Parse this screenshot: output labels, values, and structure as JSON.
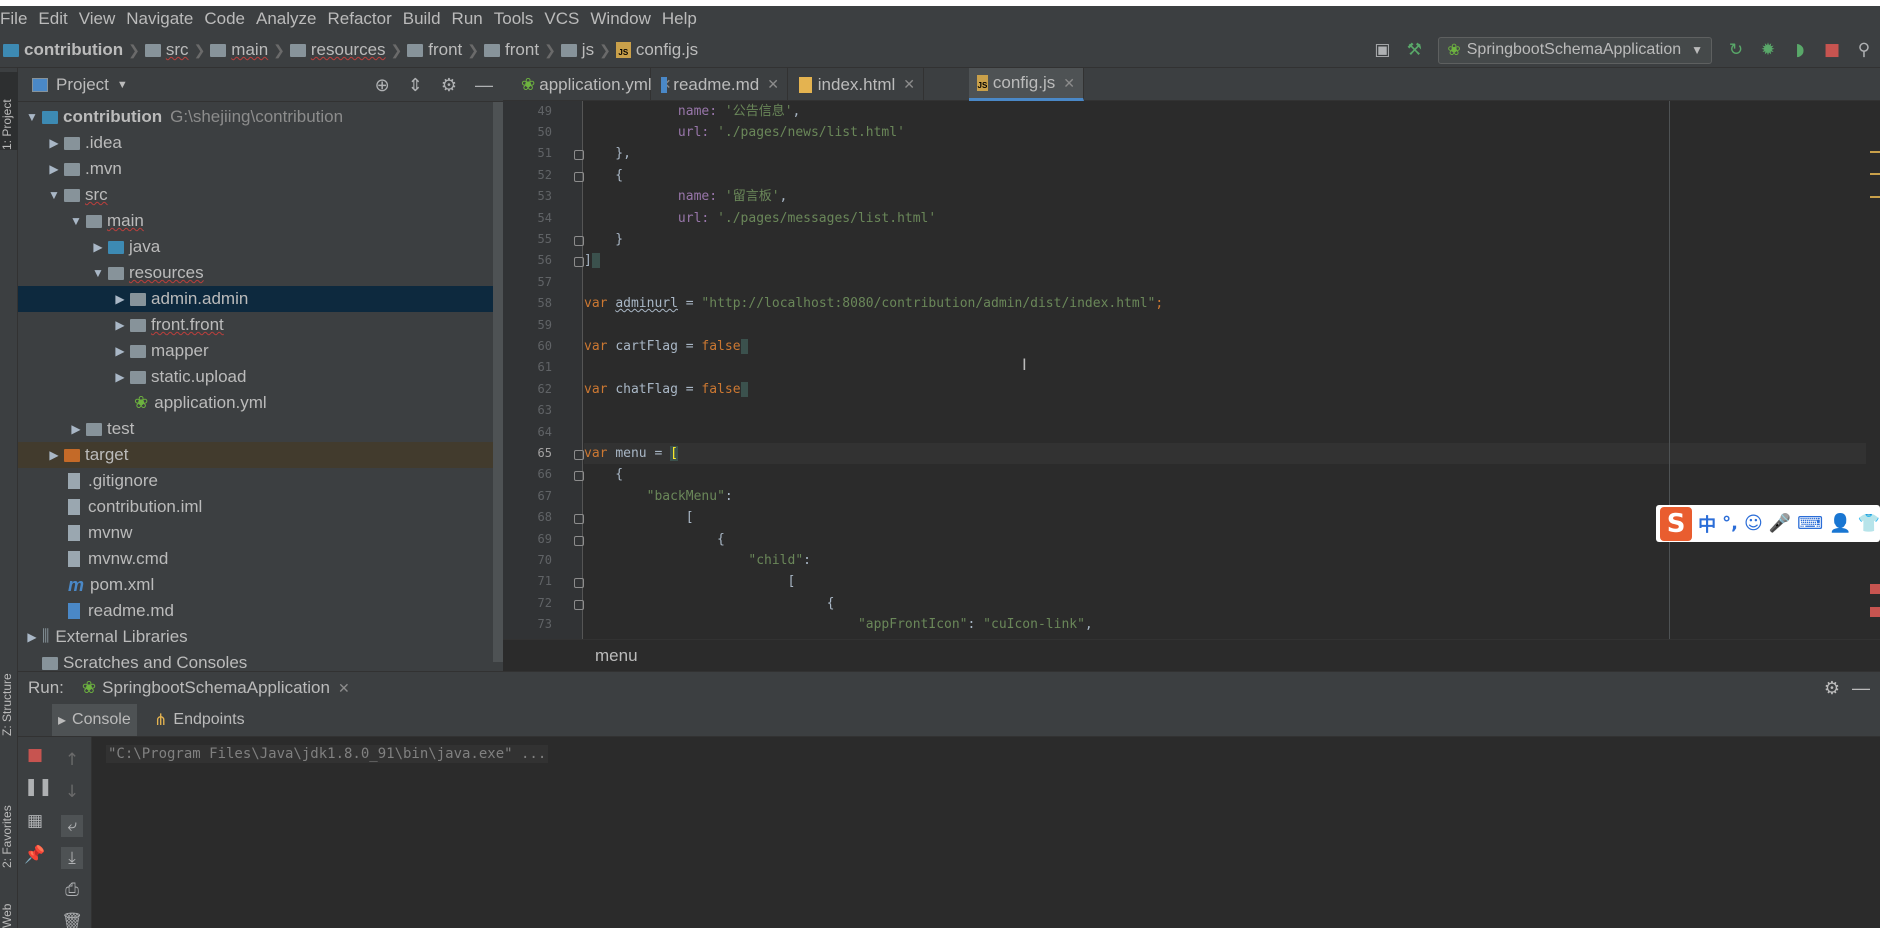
{
  "menu": [
    "File",
    "Edit",
    "View",
    "Navigate",
    "Code",
    "Analyze",
    "Refactor",
    "Build",
    "Run",
    "Tools",
    "VCS",
    "Window",
    "Help"
  ],
  "breadcrumbs": [
    "contribution",
    "src",
    "main",
    "resources",
    "front",
    "front",
    "js",
    "config.js"
  ],
  "run_config": "SpringbootSchemaApplication",
  "left_tabs": {
    "project": "1: Project",
    "structure": "Z: Structure",
    "favorites": "2: Favorites",
    "web": "Web"
  },
  "project": {
    "title": "Project",
    "tree": [
      {
        "label": "contribution",
        "hint": "G:\\shejiing\\contribution"
      },
      {
        "label": ".idea"
      },
      {
        "label": ".mvn"
      },
      {
        "label": "src"
      },
      {
        "label": "main"
      },
      {
        "label": "java"
      },
      {
        "label": "resources"
      },
      {
        "label": "admin.admin"
      },
      {
        "label": "front.front"
      },
      {
        "label": "mapper"
      },
      {
        "label": "static.upload"
      },
      {
        "label": "application.yml"
      },
      {
        "label": "test"
      },
      {
        "label": "target"
      },
      {
        "label": ".gitignore"
      },
      {
        "label": "contribution.iml"
      },
      {
        "label": "mvnw"
      },
      {
        "label": "mvnw.cmd"
      },
      {
        "label": "pom.xml"
      },
      {
        "label": "readme.md"
      },
      {
        "label": "External Libraries"
      },
      {
        "label": "Scratches and Consoles"
      }
    ]
  },
  "tabs": [
    {
      "label": "application.yml",
      "icon": "yml"
    },
    {
      "label": "readme.md",
      "icon": "MD"
    },
    {
      "label": "index.html",
      "icon": "H"
    },
    {
      "label": "config.js",
      "icon": "JS"
    }
  ],
  "editor": {
    "line_numbers": [
      "49",
      "50",
      "51",
      "52",
      "53",
      "54",
      "55",
      "56",
      "57",
      "58",
      "59",
      "60",
      "61",
      "62",
      "63",
      "64",
      "65",
      "66",
      "67",
      "68",
      "69",
      "70",
      "71",
      "72",
      "73"
    ],
    "lines": {
      "l49a": "            name: ",
      "l49b": "'公告信息'",
      "l49c": ",",
      "l50a": "            url: ",
      "l50b": "'./pages/news/list.html'",
      "l51": "    },",
      "l52": "    {",
      "l53a": "            name: ",
      "l53b": "'留言板'",
      "l53c": ",",
      "l54a": "            url: ",
      "l54b": "'./pages/messages/list.html'",
      "l55": "    }",
      "l56": "]",
      "l58a": "var ",
      "l58b": "adminurl",
      " l58c": " = ",
      "l58d": "\"http://localhost:8080/contribution/admin/dist/index.html\"",
      "l58e": ";",
      "l60a": "var ",
      "l60b": "cartFlag = ",
      "l60c": "false",
      "l62a": "var ",
      "l62b": "chatFlag = ",
      "l62c": "false",
      "l65a": "var ",
      "l65b": "menu = ",
      "l65c": "[",
      "l66": "    {",
      "l67a": "        ",
      "l67b": "\"backMenu\"",
      "l67c": ":",
      "l68": "             [",
      "l69": "                 {",
      "l70a": "                     ",
      "l70b": "\"child\"",
      "l70c": ":",
      "l71": "                          [",
      "l72": "                               {",
      "l73a": "                                   ",
      "l73b": "\"appFrontIcon\"",
      "l73c": ": ",
      "l73d": "\"cuIcon-link\"",
      "l73e": ","
    }
  },
  "code_breadcrumb": "menu",
  "ime": {
    "lang": "中",
    "punct": "°,"
  },
  "run": {
    "label": "Run:",
    "config": "SpringbootSchemaApplication",
    "tabs": [
      "Console",
      "Endpoints"
    ],
    "console_line": "\"C:\\Program Files\\Java\\jdk1.8.0_91\\bin\\java.exe\" ..."
  }
}
